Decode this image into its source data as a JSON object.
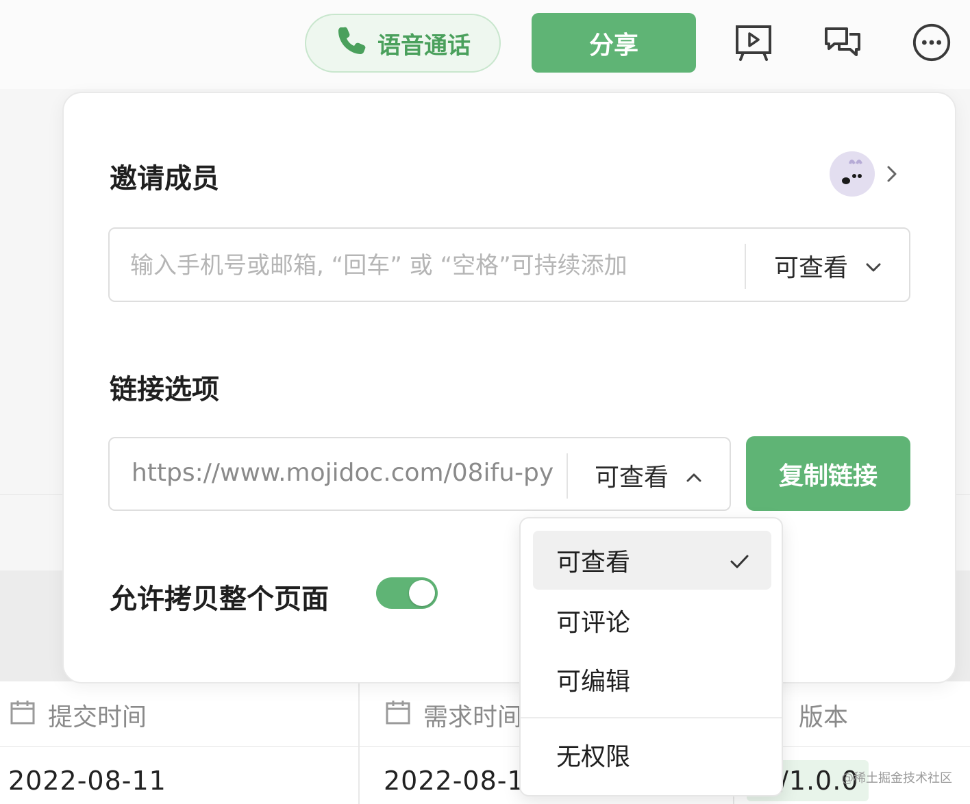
{
  "topbar": {
    "voice_call_label": "语音通话",
    "share_label": "分享",
    "icons": [
      "phone-icon",
      "presentation-icon",
      "comments-icon",
      "more-icon"
    ]
  },
  "share_panel": {
    "invite_title": "邀请成员",
    "invite_placeholder": "输入手机号或邮箱, “回车” 或 “空格”可持续添加",
    "invite_permission": "可查看",
    "link_title": "链接选项",
    "link_url": "https://www.mojidoc.com/08ifu-py",
    "link_permission": "可查看",
    "copy_link_label": "复制链接",
    "allow_copy_label": "允许拷贝整个页面",
    "allow_copy_enabled": true
  },
  "permission_dropdown": {
    "items": [
      {
        "label": "可查看",
        "selected": true
      },
      {
        "label": "可评论",
        "selected": false
      },
      {
        "label": "可编辑",
        "selected": false
      },
      {
        "label": "无权限",
        "selected": false
      }
    ]
  },
  "table": {
    "columns": [
      {
        "label": "提交时间",
        "icon": "calendar-icon"
      },
      {
        "label": "需求时间",
        "icon": "calendar-icon"
      },
      {
        "label": "版本",
        "icon": "tag-icon"
      }
    ],
    "rows": [
      {
        "submit_time": "2022-08-11",
        "request_time": "2022-08-1",
        "version": "/1.0.0"
      }
    ]
  },
  "watermark": "@稀土掘金技术社区",
  "colors": {
    "accent": "#5fb475",
    "accent_light": "#eef7ef",
    "panel_border": "#e9e9e9"
  }
}
